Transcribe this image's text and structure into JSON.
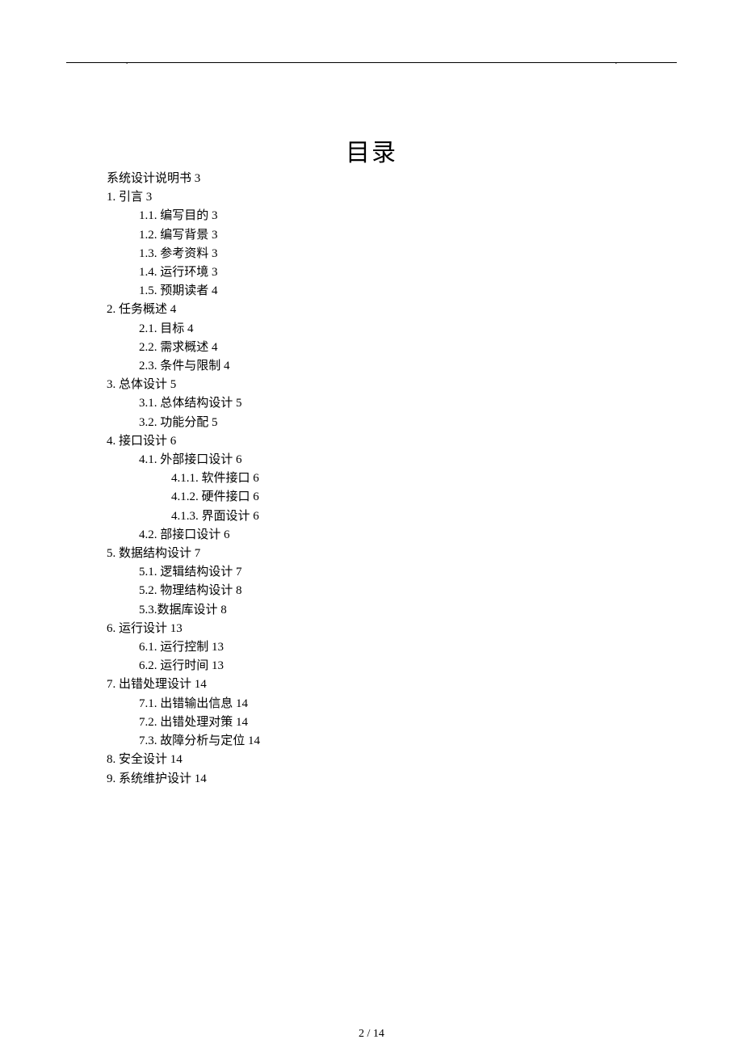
{
  "header": {
    "dot_left": ".",
    "dot_right": "."
  },
  "title": "目录",
  "toc": [
    {
      "level": 0,
      "text": "系统设计说明书 3"
    },
    {
      "level": 1,
      "text": "1. 引言 3"
    },
    {
      "level": 2,
      "text": "1.1. 编写目的 3"
    },
    {
      "level": 2,
      "text": "1.2. 编写背景 3"
    },
    {
      "level": 2,
      "text": "1.3. 参考资料 3"
    },
    {
      "level": 2,
      "text": "1.4. 运行环境 3"
    },
    {
      "level": 2,
      "text": "1.5. 预期读者 4"
    },
    {
      "level": 1,
      "text": "2. 任务概述 4"
    },
    {
      "level": 2,
      "text": "2.1. 目标 4"
    },
    {
      "level": 2,
      "text": "2.2. 需求概述 4"
    },
    {
      "level": 2,
      "text": "2.3. 条件与限制 4"
    },
    {
      "level": 1,
      "text": "3. 总体设计 5"
    },
    {
      "level": 2,
      "text": "3.1. 总体结构设计 5"
    },
    {
      "level": 2,
      "text": "3.2. 功能分配 5"
    },
    {
      "level": 1,
      "text": "4. 接口设计 6"
    },
    {
      "level": 2,
      "text": "4.1. 外部接口设计 6"
    },
    {
      "level": 3,
      "text": "4.1.1. 软件接口 6"
    },
    {
      "level": 3,
      "text": "4.1.2. 硬件接口 6"
    },
    {
      "level": 3,
      "text": "4.1.3. 界面设计 6"
    },
    {
      "level": 2,
      "text": "4.2. 部接口设计 6"
    },
    {
      "level": 1,
      "text": "5. 数据结构设计 7"
    },
    {
      "level": 2,
      "text": "5.1. 逻辑结构设计 7"
    },
    {
      "level": 2,
      "text": "5.2. 物理结构设计 8"
    },
    {
      "level": 2,
      "text": "5.3.数据库设计 8"
    },
    {
      "level": 1,
      "text": "6. 运行设计 13"
    },
    {
      "level": 2,
      "text": "6.1. 运行控制 13"
    },
    {
      "level": 2,
      "text": "6.2. 运行时间 13"
    },
    {
      "level": 1,
      "text": "7. 出错处理设计 14"
    },
    {
      "level": 2,
      "text": "7.1. 出错输出信息 14"
    },
    {
      "level": 2,
      "text": "7.2. 出错处理对策 14"
    },
    {
      "level": 2,
      "text": "7.3. 故障分析与定位 14"
    },
    {
      "level": 1,
      "text": "8. 安全设计 14"
    },
    {
      "level": 1,
      "text": "9. 系统维护设计 14"
    }
  ],
  "page_number": "2 / 14"
}
